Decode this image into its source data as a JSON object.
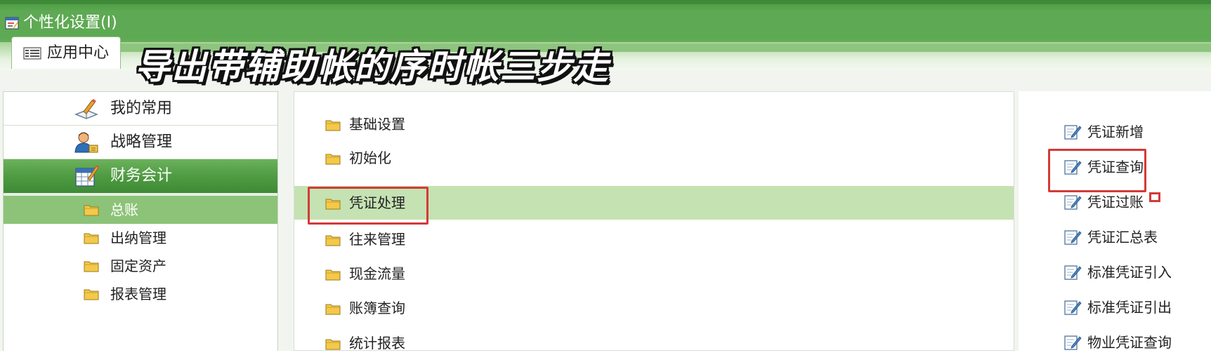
{
  "window": {
    "title": "个性化设置(I)",
    "icon": "settings-window-icon"
  },
  "tabs": [
    {
      "label": "应用中心",
      "icon": "app-center-icon",
      "active": true
    }
  ],
  "caption": "导出带辅助帐的序时帐三步走",
  "sidebar": {
    "categories": [
      {
        "label": "我的常用",
        "icon": "favorites-icon",
        "active": false
      },
      {
        "label": "战略管理",
        "icon": "strategy-user-icon",
        "active": false
      },
      {
        "label": "财务会计",
        "icon": "finance-ledger-icon",
        "active": true
      }
    ],
    "sub_items": [
      {
        "label": "总账",
        "active": true
      },
      {
        "label": "出纳管理",
        "active": false
      },
      {
        "label": "固定资产",
        "active": false
      },
      {
        "label": "报表管理",
        "active": false
      }
    ]
  },
  "modules": [
    {
      "label": "基础设置",
      "active": false
    },
    {
      "label": "初始化",
      "active": false
    },
    {
      "label": "凭证处理",
      "active": true
    },
    {
      "label": "往来管理",
      "active": false
    },
    {
      "label": "现金流量",
      "active": false
    },
    {
      "label": "账簿查询",
      "active": false
    },
    {
      "label": "统计报表",
      "active": false
    }
  ],
  "functions": [
    {
      "label": "凭证新增"
    },
    {
      "label": "凭证查询"
    },
    {
      "label": "凭证过账"
    },
    {
      "label": "凭证汇总表"
    },
    {
      "label": "标准凭证引入"
    },
    {
      "label": "标准凭证引出"
    },
    {
      "label": "物业凭证查询"
    }
  ],
  "colors": {
    "title_green": "#5ea953",
    "active_green": "#4c9a40",
    "active_row": "#c5e2b3",
    "highlight_red": "#d43a37",
    "folder_yellow": "#f4c94a"
  }
}
